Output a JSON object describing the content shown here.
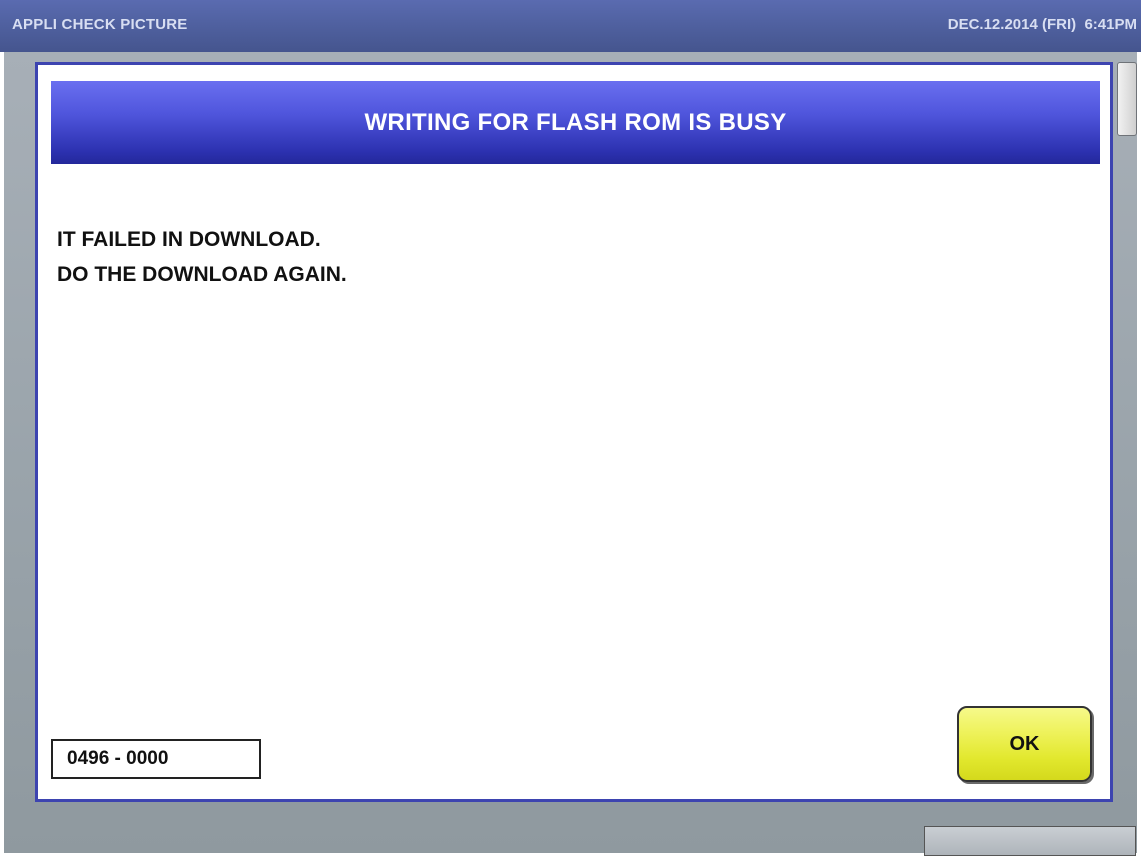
{
  "titlebar": {
    "app_title": "APPLI CHECK PICTURE",
    "datetime": "DEC.12.2014 (FRI)  6:41PM"
  },
  "dialog": {
    "title": "WRITING FOR FLASH ROM IS BUSY",
    "message_lines": [
      "IT FAILED IN DOWNLOAD.",
      "DO THE DOWNLOAD AGAIN."
    ],
    "error_code": "0496 - 0000",
    "ok_label": "OK"
  },
  "colors": {
    "titlebar": "#4f609f",
    "dialog_header": "#3a40c8",
    "dialog_border": "#3d44b0",
    "ok_button": "#e6eb3c",
    "backdrop": "#98a2a9"
  }
}
